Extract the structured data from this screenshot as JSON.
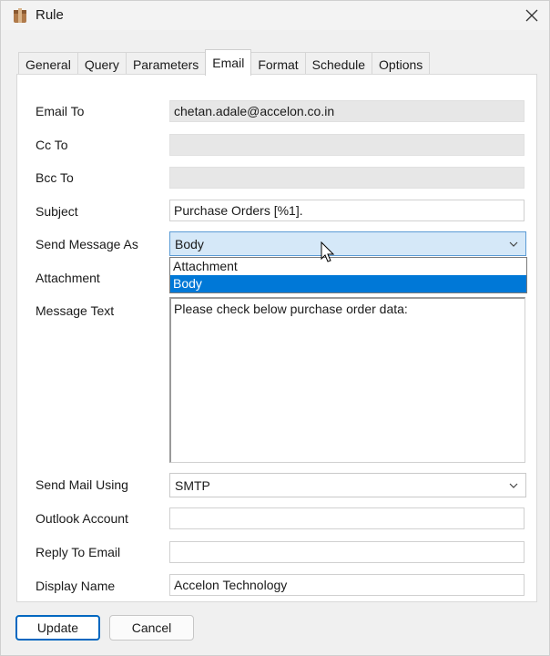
{
  "window": {
    "title": "Rule"
  },
  "tabs": [
    {
      "label": "General",
      "active": false
    },
    {
      "label": "Query",
      "active": false
    },
    {
      "label": "Parameters",
      "active": false
    },
    {
      "label": "Email",
      "active": true
    },
    {
      "label": "Format",
      "active": false
    },
    {
      "label": "Schedule",
      "active": false
    },
    {
      "label": "Options",
      "active": false
    }
  ],
  "form": {
    "email_to": {
      "label": "Email To",
      "value": "chetan.adale@accelon.co.in"
    },
    "cc_to": {
      "label": "Cc To",
      "value": ""
    },
    "bcc_to": {
      "label": "Bcc To",
      "value": ""
    },
    "subject": {
      "label": "Subject",
      "value": "Purchase Orders [%1]."
    },
    "send_message_as": {
      "label": "Send Message As",
      "value": "Body",
      "options": [
        "Attachment",
        "Body"
      ],
      "selected_option": "Body"
    },
    "attachment": {
      "label": "Attachment"
    },
    "message_text": {
      "label": "Message Text",
      "value": "Please check below purchase order data:"
    },
    "send_mail_using": {
      "label": "Send Mail Using",
      "value": "SMTP"
    },
    "outlook_account": {
      "label": "Outlook Account",
      "value": ""
    },
    "reply_to_email": {
      "label": "Reply To Email",
      "value": ""
    },
    "display_name": {
      "label": "Display Name",
      "value": "Accelon Technology"
    }
  },
  "buttons": {
    "update": "Update",
    "cancel": "Cancel"
  },
  "icons": {
    "app": "box-icon",
    "close": "close-icon",
    "chevron": "chevron-down-icon",
    "cursor": "mouse-pointer-icon"
  },
  "colors": {
    "selection": "#0078d7",
    "open_combo": "#d5e8f8",
    "primary_border": "#0067c0"
  }
}
